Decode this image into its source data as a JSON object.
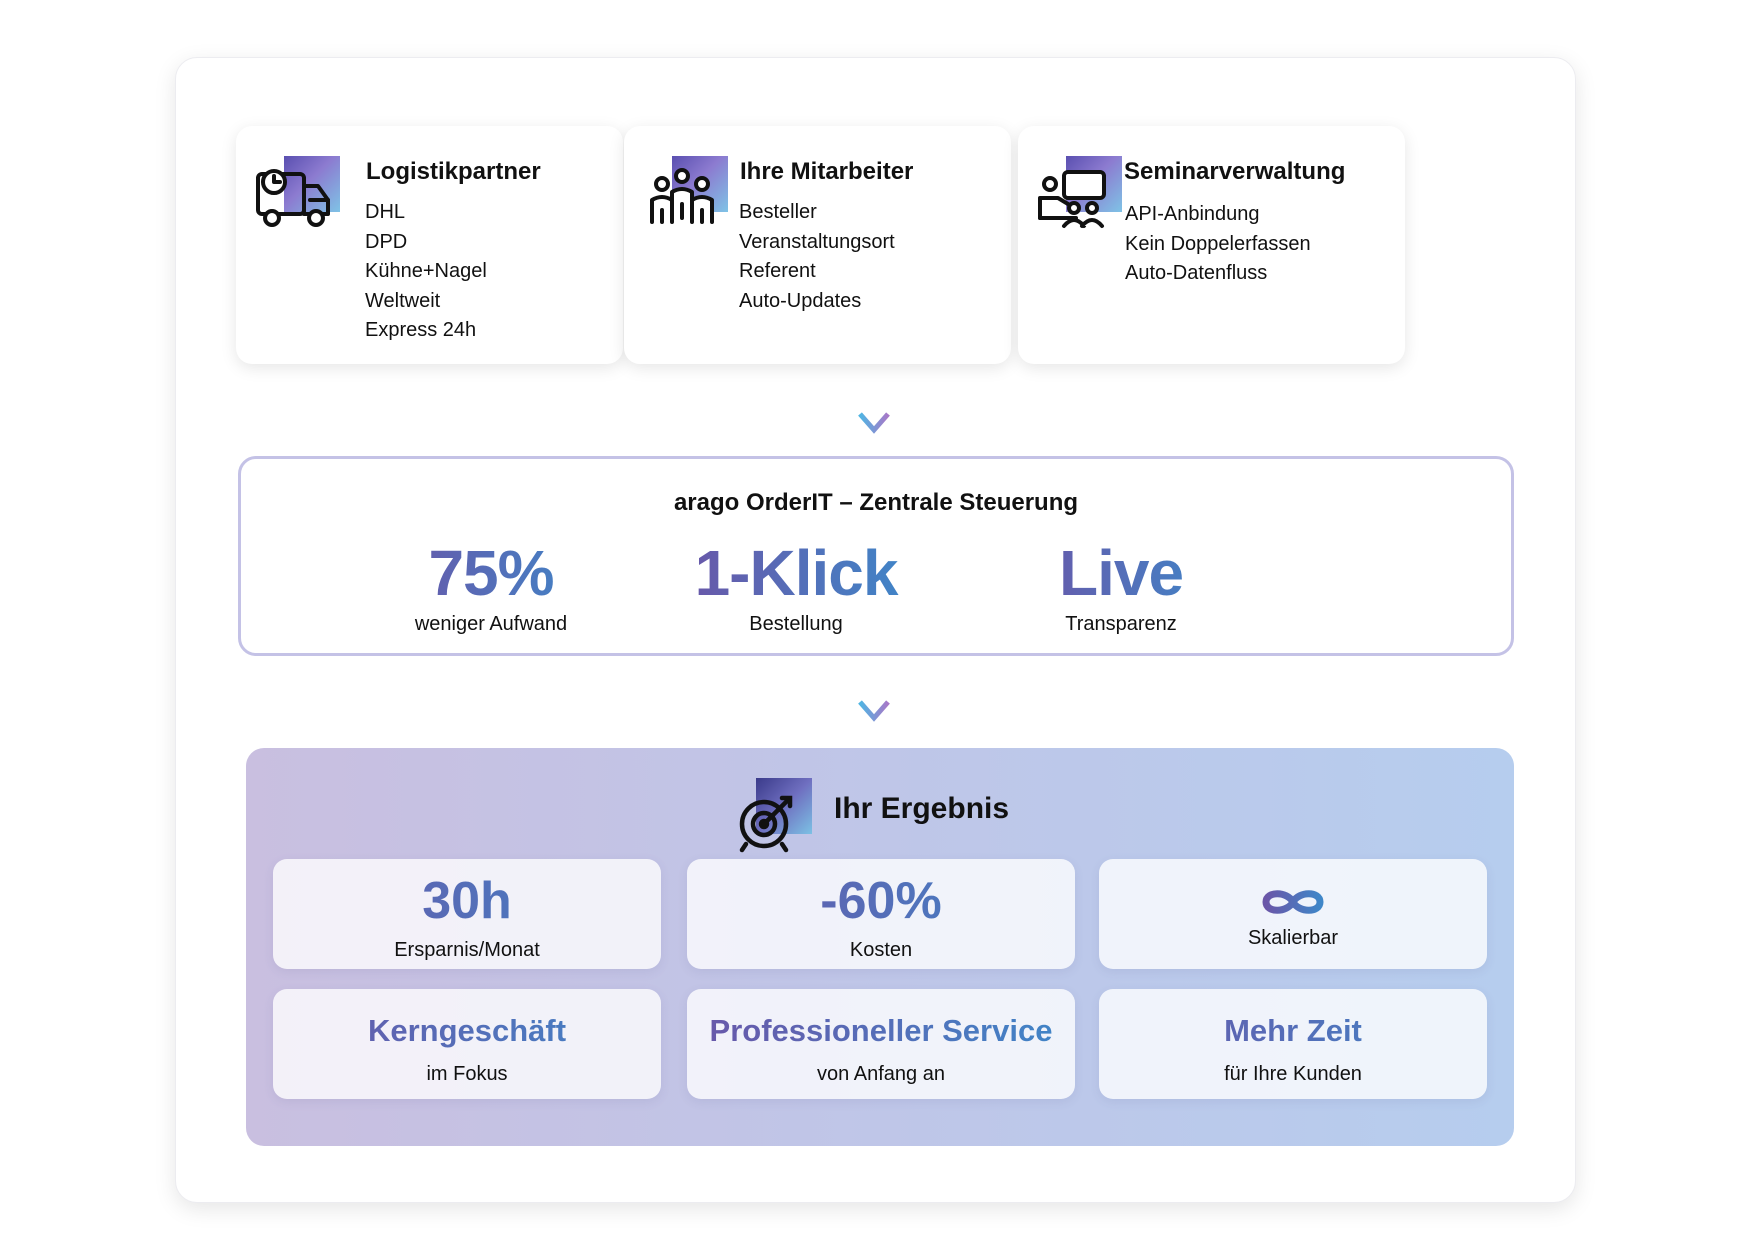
{
  "sources": [
    {
      "title": "Logistikpartner",
      "icon": "truck-clock-icon",
      "items": [
        "DHL",
        "DPD",
        "Kühne+Nagel",
        "Weltweit",
        "Express 24h"
      ]
    },
    {
      "title": "Ihre Mitarbeiter",
      "icon": "team-icon",
      "items": [
        "Besteller",
        "Veranstaltungsort",
        "Referent",
        "Auto-Updates"
      ]
    },
    {
      "title": "Seminarverwaltung",
      "icon": "presentation-icon",
      "items": [
        "API-Anbindung",
        "Kein Doppelerfassen",
        "Auto-Datenfluss"
      ]
    }
  ],
  "hub": {
    "title": "arago OrderIT – Zentrale Steuerung",
    "metrics": [
      {
        "value": "75%",
        "label": "weniger Aufwand"
      },
      {
        "value": "1-Klick",
        "label": "Bestellung"
      },
      {
        "value": "Live",
        "label": "Transparenz"
      }
    ]
  },
  "result": {
    "title": "Ihr Ergebnis",
    "icon": "target-icon",
    "tiles_top": [
      {
        "value": "30h",
        "label": "Ersparnis/Monat"
      },
      {
        "value": "-60%",
        "label": "Kosten"
      },
      {
        "value": "",
        "label": "Skalierbar",
        "icon": "infinity-icon"
      }
    ],
    "tiles_bottom": [
      {
        "title": "Kerngeschäft",
        "label": "im Fokus"
      },
      {
        "title": "Professioneller Service",
        "label": "von Anfang an"
      },
      {
        "title": "Mehr Zeit",
        "label": "für Ihre Kunden"
      }
    ]
  },
  "colors": {
    "gradient_start": "#6a56a8",
    "gradient_end": "#3f86c8",
    "hub_border": "#c4c2e6",
    "result_bg_start": "#c9bfe0",
    "result_bg_end": "#b6cdee"
  }
}
